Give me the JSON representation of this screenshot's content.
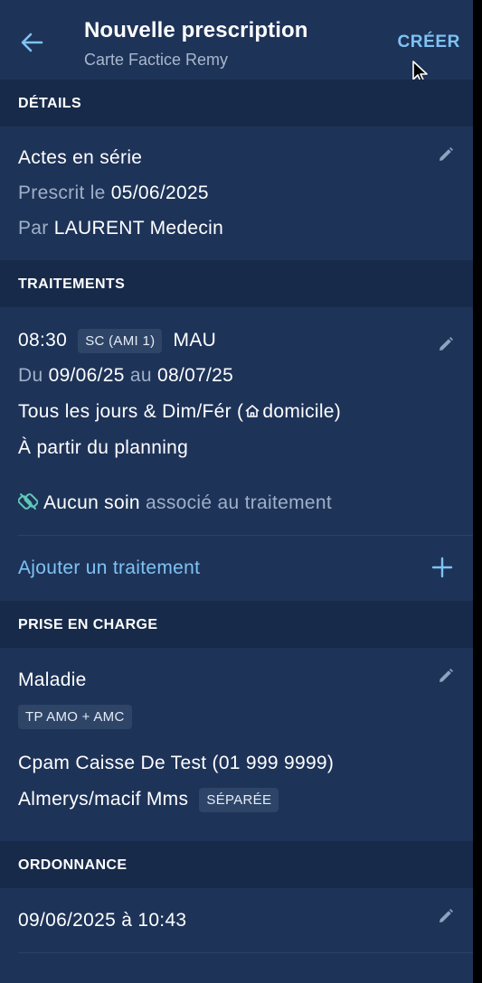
{
  "header": {
    "title": "Nouvelle prescription",
    "subtitle": "Carte Factice Remy",
    "create_label": "CRÉER",
    "back_icon": "arrow-left-icon"
  },
  "details": {
    "heading": "DÉTAILS",
    "type": "Actes en série",
    "prescribed_prefix": "Prescrit le",
    "prescribed_date": "05/06/2025",
    "by_prefix": "Par",
    "by_name": "LAURENT Medecin"
  },
  "traitements": {
    "heading": "TRAITEMENTS",
    "time": "08:30",
    "act_badge": "SC (AMI 1)",
    "act_code": "MAU",
    "from_prefix": "Du",
    "from_date": "09/06/25",
    "to_prefix": "au",
    "to_date": "08/07/25",
    "frequency_prefix": "Tous les jours & Dim/Fér (",
    "location": "domicile)",
    "planning": "À partir du planning",
    "no_care_strong": "Aucun soin",
    "no_care_rest": "associé au traitement",
    "add_label": "Ajouter un traitement"
  },
  "prise_en_charge": {
    "heading": "PRISE EN CHARGE",
    "type": "Maladie",
    "coverage_badge": "TP AMO + AMC",
    "amo": "Cpam Caisse De Test (01 999 9999)",
    "amc": "Almerys/macif Mms",
    "amc_badge": "SÉPARÉE"
  },
  "ordonnance": {
    "heading": "ORDONNANCE",
    "date": "09/06/2025 à 10:43"
  },
  "colors": {
    "background": "#1e3358",
    "section_header": "#172a49",
    "accent": "#7ec3f4",
    "muted_text": "#9fb0c9",
    "badge_bg": "#2e4568"
  }
}
